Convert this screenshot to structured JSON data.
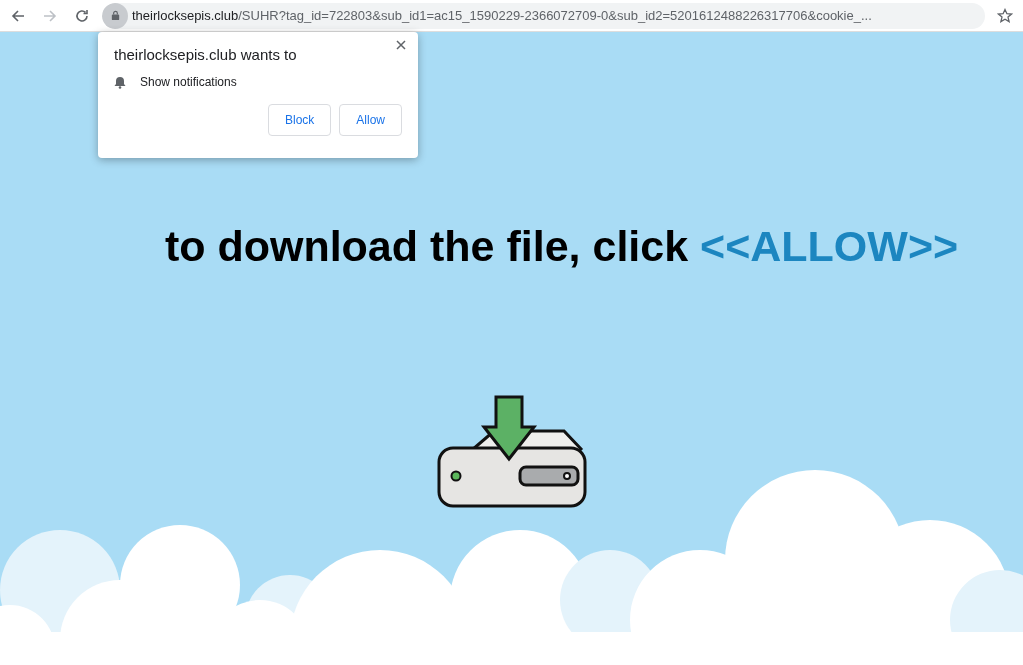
{
  "browser": {
    "url_host": "theirlocksepis.club",
    "url_path": "/SUHR?tag_id=722803&sub_id1=ac15_1590229-2366072709-0&sub_id2=5201612488226317706&cookie_..."
  },
  "permission_popup": {
    "title": "theirlocksepis.club wants to",
    "permission": "Show notifications",
    "buttons": [
      "Block",
      "Allow"
    ]
  },
  "page": {
    "headline": "to download the file, click ",
    "headline_highlight": "<<ALLOW>>"
  }
}
